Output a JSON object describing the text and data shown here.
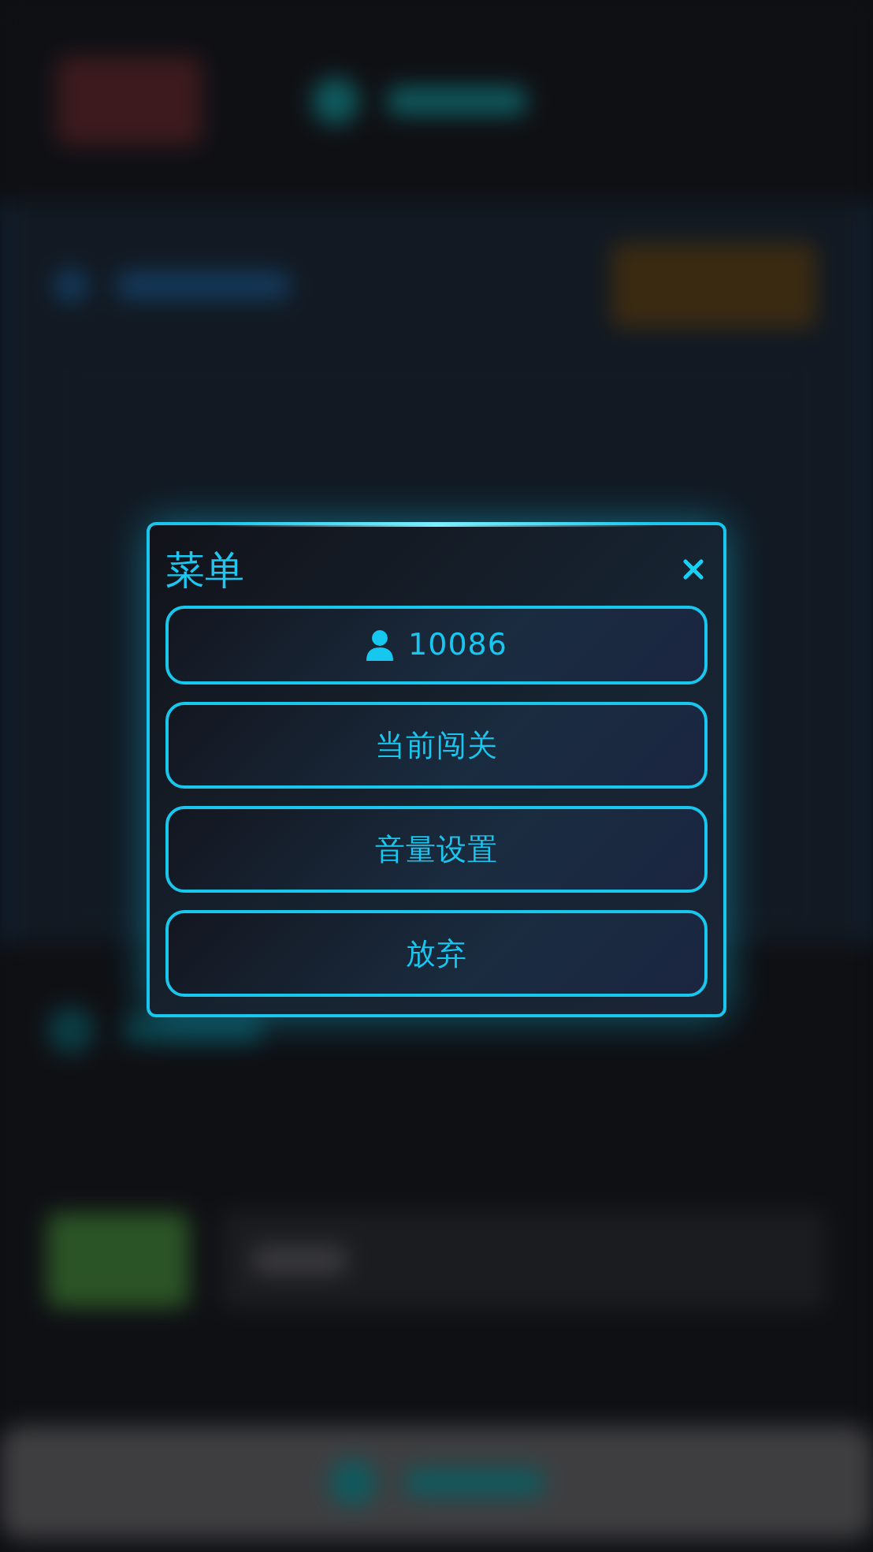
{
  "dialog": {
    "title": "菜单",
    "items": [
      {
        "kind": "user",
        "label": "10086"
      },
      {
        "kind": "plain",
        "label": "当前闯关"
      },
      {
        "kind": "plain",
        "label": "音量设置"
      },
      {
        "kind": "plain",
        "label": "放弃"
      }
    ]
  }
}
